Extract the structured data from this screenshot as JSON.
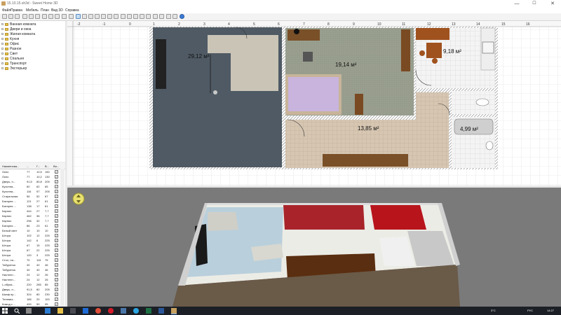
{
  "window": {
    "title": "15.10.15.sh3d - Sweet Home 3D",
    "controls": {
      "minimize": "—",
      "maximize": "☐",
      "close": "✕"
    }
  },
  "menu": [
    "Файл",
    "Правка",
    "Мебель",
    "План",
    "Вид 3D",
    "Справка"
  ],
  "toolbar": {
    "icons": [
      "new-file-icon",
      "open-folder-icon",
      "save-icon",
      "cut-icon",
      "copy-icon",
      "paste-icon",
      "undo-icon",
      "redo-icon",
      "delete-icon",
      "add-furniture-icon",
      "select-arrow-icon",
      "pan-hand-icon",
      "create-walls-icon",
      "create-rooms-icon",
      "create-polylines-icon",
      "create-dimensions-icon",
      "add-text-icon",
      "rotate-icon",
      "text-style-icon",
      "zoom-in-icon",
      "zoom-out-icon",
      "create-photo-icon",
      "create-video-icon",
      "help-icon"
    ]
  },
  "catalog": {
    "categories": [
      "Ванная комната",
      "Двери и окна",
      "Жилая комната",
      "Кухня",
      "Офис",
      "Разное",
      "Свет",
      "Спальня",
      "Транспорт",
      "Экстерьер"
    ]
  },
  "furniture_table": {
    "headers": [
      "Наименова...",
      "...",
      "Г...",
      "В...",
      "Ви..."
    ],
    "rows": [
      [
        "Окно",
        "77",
        "10,5",
        "150",
        "✓"
      ],
      [
        "Окно",
        "77",
        "10,2",
        "130",
        "✓"
      ],
      [
        "Дверь, н...",
        "91,5",
        "80,8",
        "205",
        "✓"
      ],
      [
        "Кухонна...",
        "60",
        "62",
        "65",
        "✓"
      ],
      [
        "Кухонна...",
        "116",
        "57",
        "205",
        "✓"
      ],
      [
        "Стиральная",
        "56",
        "52",
        "67",
        "✓"
      ],
      [
        "Батарея ...",
        "121",
        "27",
        "61",
        "✓"
      ],
      [
        "Батарея ...",
        "138",
        "17",
        "61",
        "✓"
      ],
      [
        "Карниз",
        "444",
        "27",
        "7,7",
        "✓"
      ],
      [
        "Карниз",
        "462",
        "36",
        "7,7",
        "✓"
      ],
      [
        "Карниз",
        "296",
        "32",
        "7,7",
        "✓"
      ],
      [
        "Батарея ...",
        "86",
        "23",
        "61",
        "✓"
      ],
      [
        "Белый свет",
        "10",
        "10",
        "10",
        "✓"
      ],
      [
        "Штора",
        "102",
        "12",
        "225",
        "✓"
      ],
      [
        "Штора",
        "142",
        "6",
        "225",
        "✓"
      ],
      [
        "Штора",
        "67",
        "15",
        "225",
        "✓"
      ],
      [
        "Штора",
        "67",
        "22",
        "225",
        "✓"
      ],
      [
        "Штора",
        "120",
        "3",
        "225",
        "✓"
      ],
      [
        "Стол, на...",
        "70",
        "115",
        "75",
        "✓"
      ],
      [
        "Табуретка",
        "40",
        "40",
        "46",
        "✓"
      ],
      [
        "Табуретка",
        "40",
        "40",
        "46",
        "✓"
      ],
      [
        "Настенн...",
        "24",
        "12",
        "26",
        "✓"
      ],
      [
        "Настенн...",
        "24",
        "12",
        "26",
        "✓"
      ],
      [
        "L-образ...",
        "220",
        "285",
        "85",
        "✓"
      ],
      [
        "Дверь, н...",
        "91,5",
        "80",
        "205",
        "✓"
      ],
      [
        "Шкаф пр...",
        "324",
        "80",
        "230",
        "✓"
      ],
      [
        "Телевиз...",
        "185",
        "20",
        "100",
        "✓"
      ],
      [
        "Комод с ...",
        "400",
        "50",
        "95",
        "✓"
      ]
    ]
  },
  "plan": {
    "ruler_labels": [
      "-2",
      "-1",
      "0",
      "1",
      "2",
      "3",
      "4",
      "5",
      "6",
      "7",
      "8",
      "9",
      "10",
      "11",
      "12",
      "13",
      "14",
      "15",
      "16"
    ],
    "rooms": [
      {
        "area": "29,12 м²"
      },
      {
        "area": "19,14 м²"
      },
      {
        "area": "9,18 м²"
      },
      {
        "area": "13,85 м²"
      },
      {
        "area": "4,99 м²"
      }
    ]
  },
  "taskbar": {
    "icons": [
      "windows-start-icon",
      "search-icon",
      "task-view-icon",
      "edge-icon",
      "explorer-icon",
      "store-icon",
      "mail-icon",
      "chrome-icon",
      "opera-icon",
      "vk-icon",
      "telegram-icon",
      "excel-icon",
      "word-icon",
      "sweethome3d-icon"
    ],
    "tray_temp": "3°C",
    "tray_lang": "РУС",
    "clock": "14:27"
  },
  "colors": {
    "accent": "#0078d7",
    "room_gray": "#4f5a64",
    "grid": "#dcdcdc",
    "taskbar": "#1c2026"
  }
}
